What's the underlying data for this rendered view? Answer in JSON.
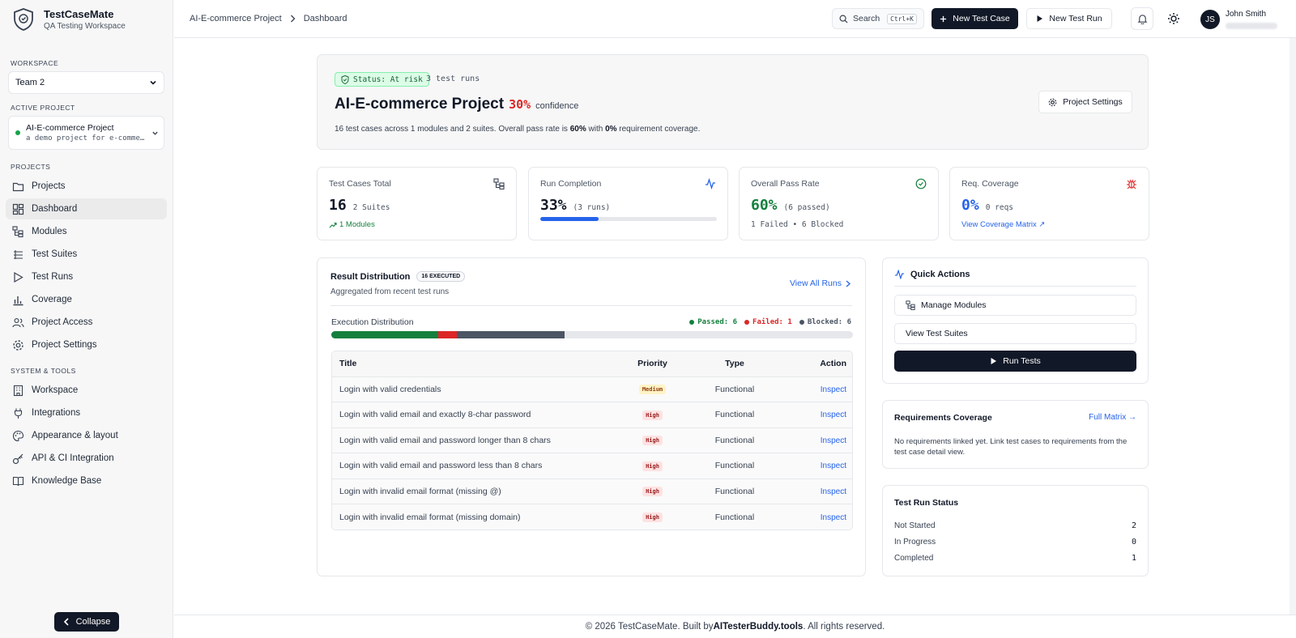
{
  "app": {
    "name": "TestCaseMate",
    "subtitle": "QA Testing Workspace"
  },
  "sidebar": {
    "workspace_label": "WORKSPACE",
    "workspace_value": "Team 2",
    "active_project_label": "ACTIVE PROJECT",
    "active_project_name": "AI-E-commerce Project",
    "active_project_desc": "a demo project for e-commerce testi…",
    "projects_label": "PROJECTS",
    "projects_items": [
      {
        "label": "Projects",
        "icon": "folder-icon"
      },
      {
        "label": "Dashboard",
        "icon": "dashboard-icon"
      },
      {
        "label": "Modules",
        "icon": "modules-icon"
      },
      {
        "label": "Test Suites",
        "icon": "test-suites-icon"
      },
      {
        "label": "Test Runs",
        "icon": "play-icon"
      },
      {
        "label": "Coverage",
        "icon": "bar-chart-icon"
      },
      {
        "label": "Project Access",
        "icon": "users-icon"
      },
      {
        "label": "Project Settings",
        "icon": "gear-icon"
      }
    ],
    "system_label": "SYSTEM & TOOLS",
    "system_items": [
      {
        "label": "Workspace",
        "icon": "building-icon"
      },
      {
        "label": "Integrations",
        "icon": "plug-icon"
      },
      {
        "label": "Appearance & layout",
        "icon": "palette-icon"
      },
      {
        "label": "API & CI Integration",
        "icon": "key-icon"
      },
      {
        "label": "Knowledge Base",
        "icon": "book-icon"
      }
    ],
    "collapse_label": "Collapse"
  },
  "header": {
    "breadcrumb": [
      "AI-E-commerce Project",
      "Dashboard"
    ],
    "search_label": "Search",
    "search_shortcut": "Ctrl+K",
    "new_test_case": "New Test Case",
    "new_test_run": "New Test Run",
    "user_initials": "JS",
    "user_name": "John Smith"
  },
  "hero": {
    "status": "Status: At risk",
    "runs": "3 test runs",
    "title": "AI-E-commerce Project",
    "confidence_pct": "30%",
    "confidence_label": "confidence",
    "desc_prefix": "16 test cases across 1 modules and 2 suites. Overall pass rate is ",
    "desc_pass": "60%",
    "desc_mid": " with ",
    "desc_cov": "0%",
    "desc_suffix": " requirement coverage.",
    "settings_label": "Project Settings"
  },
  "stats": [
    {
      "label": "Test Cases Total",
      "value": "16",
      "note": "2 Suites",
      "foot": "1 Modules",
      "icon": "modules-icon"
    },
    {
      "label": "Run Completion",
      "value": "33%",
      "note": "(3 runs)",
      "progress": 0.33,
      "icon": "activity-icon"
    },
    {
      "label": "Overall Pass Rate",
      "value": "60%",
      "note": "(6 passed)",
      "foot": "1 Failed • 6 Blocked",
      "icon": "check-circle-icon"
    },
    {
      "label": "Req. Coverage",
      "value": "0%",
      "note": "0 reqs",
      "foot": "View Coverage Matrix ↗",
      "icon": "bug-icon"
    }
  ],
  "distribution": {
    "title": "Result Distribution",
    "executed_badge": "16 EXECUTED",
    "subtitle": "Aggregated from recent test runs",
    "view_all": "View All Runs",
    "exec_label": "Execution Distribution",
    "legend": [
      {
        "label": "Passed: 6",
        "color": "#15803d"
      },
      {
        "label": "Failed: 1",
        "color": "#dc2626"
      },
      {
        "label": "Blocked: 6",
        "color": "#4b5563"
      }
    ],
    "segments": [
      {
        "fraction": 0.205,
        "color": "#15803d"
      },
      {
        "fraction": 0.035,
        "color": "#dc2626"
      },
      {
        "fraction": 0.207,
        "color": "#4b5563"
      }
    ]
  },
  "table": {
    "headers": [
      "Title",
      "Priority",
      "Type",
      "Action"
    ],
    "rows": [
      {
        "title": "Login with valid credentials",
        "priority": "Medium",
        "type": "Functional",
        "action": "Inspect"
      },
      {
        "title": "Login with valid email and exactly 8-char password",
        "priority": "High",
        "type": "Functional",
        "action": "Inspect"
      },
      {
        "title": "Login with valid email and password longer than 8 chars",
        "priority": "High",
        "type": "Functional",
        "action": "Inspect"
      },
      {
        "title": "Login with valid email and password less than 8 chars",
        "priority": "High",
        "type": "Functional",
        "action": "Inspect"
      },
      {
        "title": "Login with invalid email format (missing @)",
        "priority": "High",
        "type": "Functional",
        "action": "Inspect"
      },
      {
        "title": "Login with invalid email format (missing domain)",
        "priority": "High",
        "type": "Functional",
        "action": "Inspect"
      }
    ]
  },
  "quick_actions": {
    "title": "Quick Actions",
    "manage_modules": "Manage Modules",
    "view_suites": "View Test Suites",
    "run_tests": "Run Tests"
  },
  "requirements": {
    "title": "Requirements Coverage",
    "link": "Full Matrix →",
    "text": "No requirements linked yet. Link test cases to requirements from the test case detail view."
  },
  "run_status": {
    "title": "Test Run Status",
    "rows": [
      {
        "label": "Not Started",
        "value": "2"
      },
      {
        "label": "In Progress",
        "value": "0"
      },
      {
        "label": "Completed",
        "value": "1"
      }
    ]
  },
  "footer": {
    "prefix": "© 2026 TestCaseMate. Built by ",
    "brand": "AITesterBuddy.tools",
    "suffix": ". All rights reserved."
  }
}
